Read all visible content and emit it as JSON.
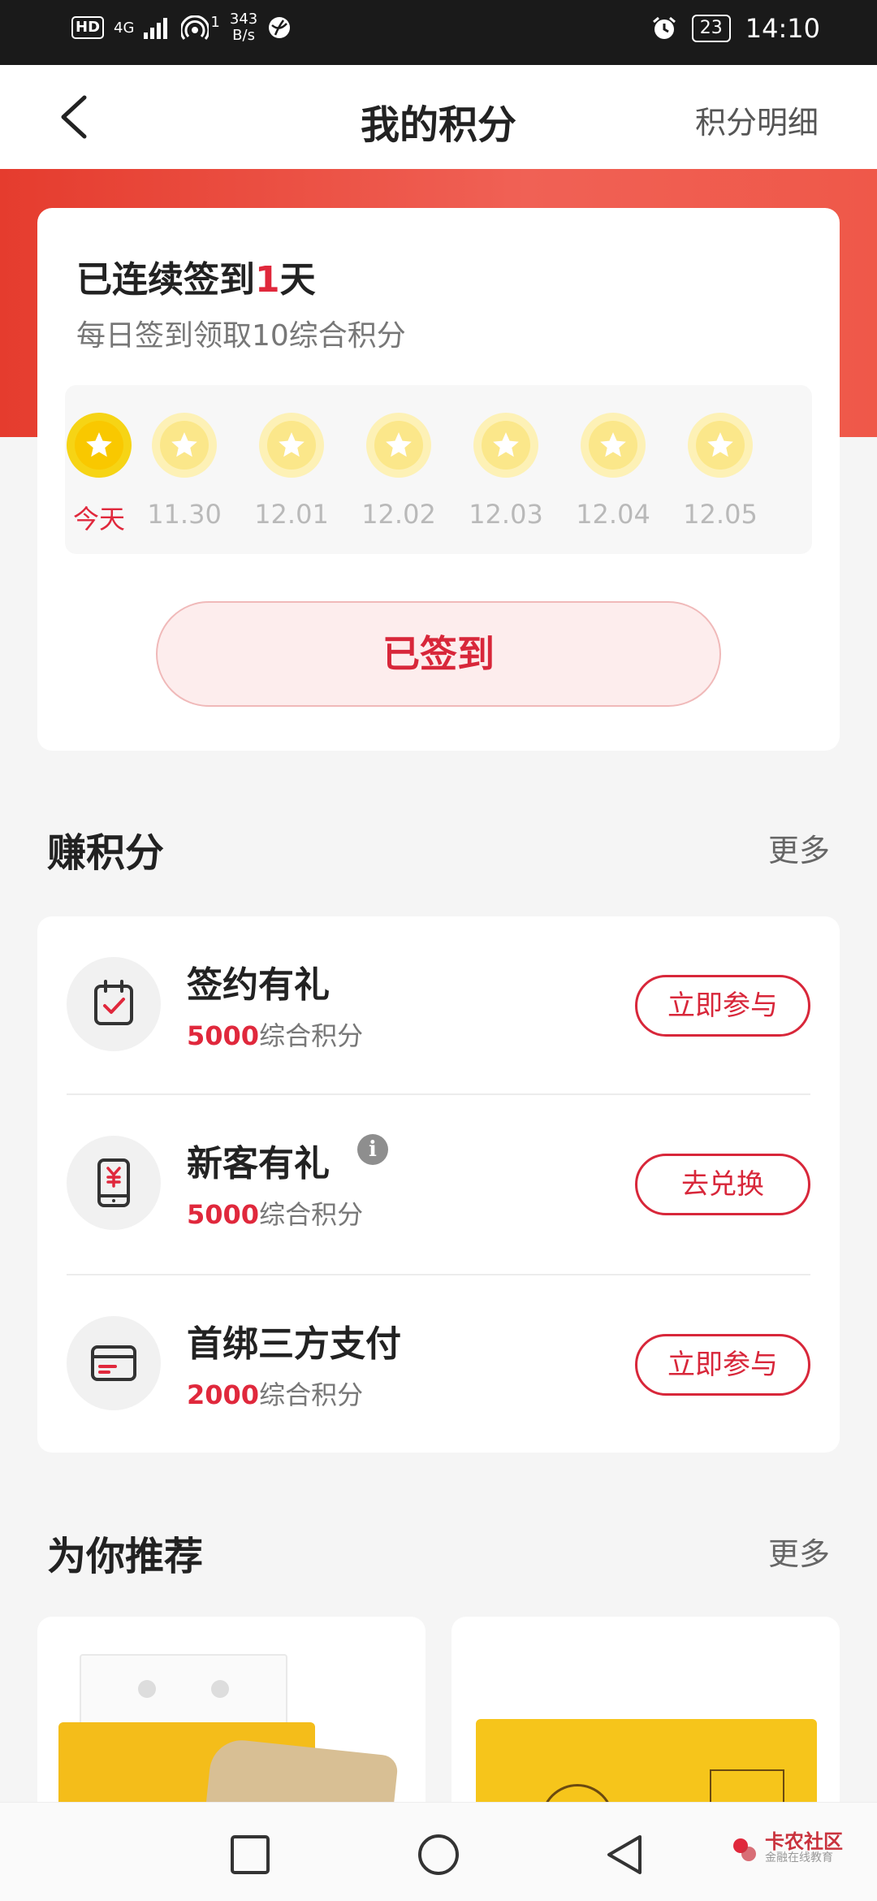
{
  "status_bar": {
    "hd": "HD",
    "network": "4G",
    "speed_value": "343",
    "speed_unit": "B/s",
    "hotspot_count": "1",
    "battery": "23",
    "time": "14:10"
  },
  "header": {
    "title": "我的积分",
    "detail_link": "积分明细"
  },
  "sign_in": {
    "streak_prefix": "已连续签到",
    "streak_days": "1",
    "streak_suffix": "天",
    "subtitle": "每日签到领取10综合积分",
    "days": [
      {
        "label": "今天",
        "active": true
      },
      {
        "label": "11.30",
        "active": false
      },
      {
        "label": "12.01",
        "active": false
      },
      {
        "label": "12.02",
        "active": false
      },
      {
        "label": "12.03",
        "active": false
      },
      {
        "label": "12.04",
        "active": false
      },
      {
        "label": "12.05",
        "active": false
      }
    ],
    "button_label": "已签到"
  },
  "earn": {
    "title": "赚积分",
    "more": "更多",
    "tasks": [
      {
        "name": "签约有礼",
        "points": "5000",
        "points_unit": "综合积分",
        "button": "立即参与",
        "icon": "calendar-check-icon"
      },
      {
        "name": "新客有礼",
        "points": "5000",
        "points_unit": "综合积分",
        "button": "去兑换",
        "icon": "phone-yuan-icon",
        "info": "i"
      },
      {
        "name": "首绑三方支付",
        "points": "2000",
        "points_unit": "综合积分",
        "button": "立即参与",
        "icon": "card-icon"
      }
    ]
  },
  "recommend": {
    "title": "为你推荐",
    "more": "更多"
  },
  "watermark": {
    "title": "卡农社区",
    "subtitle": "金融在线教育"
  },
  "colors": {
    "accent": "#d8273a",
    "banner": "#e53c2e",
    "coin": "#f9c800"
  }
}
